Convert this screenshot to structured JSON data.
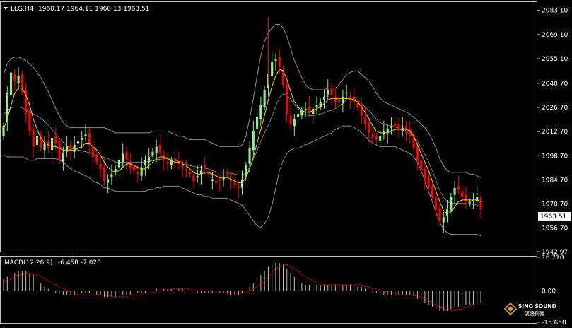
{
  "header": {
    "symbol_line": "LLG,H4",
    "ohlc": "1960.17 1964.11 1960.13 1963.51"
  },
  "macd_header": {
    "label": "MACD(12,26,9)",
    "values": "-6.458 -7.020"
  },
  "colors": {
    "background": "#000000",
    "axis": "#c0c0c0",
    "bull": "#90ee90",
    "bear": "#ff0000",
    "bands": "#8c8c8c",
    "ma": "#ffd400",
    "macd_hist": "#c0c0c0",
    "macd_signal": "#ff0000",
    "price_tag_bg": "#ffffff"
  },
  "logo": {
    "name": "SINO SOUND",
    "sub": "漢聲集團",
    "icon": "diamond-logo-icon"
  },
  "chart_data": [
    {
      "type": "candlestick",
      "panel": "main",
      "ylim": [
        1942.97,
        2087.5
      ],
      "y_ticks": [
        "2083.10",
        "2069.10",
        "2055.10",
        "2040.70",
        "2026.70",
        "2012.70",
        "1998.70",
        "1984.70",
        "1970.70",
        "1963.51",
        "1956.70",
        "1942.97"
      ],
      "y_tick_values": [
        2083.1,
        2069.1,
        2055.1,
        2040.7,
        2026.7,
        2012.7,
        1998.7,
        1984.7,
        1970.7,
        1956.7,
        1942.97
      ],
      "current_price": "1963.51",
      "current_price_value": 1963.51,
      "overlays": [
        "bollinger_upper",
        "bollinger_middle",
        "bollinger_lower",
        "moving_average"
      ],
      "close": [
        2016,
        2035,
        2047,
        2042,
        2045,
        2036,
        2023,
        2013,
        2004,
        2010,
        2003,
        2006,
        2003,
        2009,
        2006,
        1996,
        2000,
        2004,
        2002,
        2005,
        2007,
        2009,
        2011,
        2005,
        1998,
        1995,
        1991,
        1984,
        1985,
        1988,
        1991,
        1996,
        2000,
        1996,
        1992,
        1990,
        1988,
        1992,
        1996,
        1998,
        2001,
        2004,
        2000,
        1996,
        1994,
        1996,
        1996,
        1994,
        1992,
        1990,
        1988,
        1984,
        1987,
        1990,
        1992,
        1988,
        1985,
        1983,
        1984,
        1986,
        1988,
        1984,
        1982,
        1980,
        1985,
        1993,
        2003,
        2013,
        2021,
        2028,
        2037,
        2046,
        2053,
        2055,
        2050,
        2040,
        2023,
        2017,
        2020,
        2023,
        2025,
        2026,
        2024,
        2026,
        2028,
        2030,
        2033,
        2037,
        2034,
        2030,
        2030,
        2033,
        2034,
        2032,
        2030,
        2027,
        2022,
        2017,
        2012,
        2009,
        2008,
        2010,
        2013,
        2014,
        2016,
        2016,
        2014,
        2015,
        2013,
        2010,
        2003,
        1995,
        1990,
        1985,
        1980,
        1974,
        1967,
        1961,
        1963,
        1968,
        1975,
        1980,
        1979,
        1975,
        1972,
        1972,
        1973,
        1975,
        1968
      ],
      "open": [
        2010,
        2018,
        2034,
        2046,
        2041,
        2046,
        2037,
        2024,
        2014,
        2005,
        2011,
        2002,
        2007,
        2002,
        2010,
        2007,
        1995,
        2001,
        2005,
        2001,
        2006,
        2008,
        2010,
        2012,
        2004,
        1999,
        1994,
        1992,
        1983,
        1986,
        1989,
        1992,
        1995,
        2001,
        1995,
        1993,
        1989,
        1987,
        1993,
        1995,
        1999,
        2000,
        2005,
        1999,
        1995,
        1993,
        1997,
        1995,
        1993,
        1991,
        1989,
        1987,
        1986,
        1988,
        1993,
        1989,
        1984,
        1984,
        1985,
        1985,
        1989,
        1985,
        1983,
        1981,
        1980,
        1986,
        1994,
        2002,
        2014,
        2020,
        2027,
        2038,
        2045,
        2054,
        2056,
        2049,
        2041,
        2022,
        2016,
        2021,
        2022,
        2026,
        2027,
        2023,
        2027,
        2027,
        2031,
        2034,
        2038,
        2033,
        2031,
        2029,
        2034,
        2033,
        2033,
        2029,
        2028,
        2021,
        2018,
        2011,
        2010,
        2007,
        2011,
        2012,
        2015,
        2017,
        2017,
        2013,
        2016,
        2014,
        2011,
        2004,
        1996,
        1991,
        1986,
        1981,
        1975,
        1968,
        1960,
        1964,
        1967,
        1976,
        1981,
        1978,
        1976,
        1971,
        1973,
        1972,
        1974
      ],
      "bb_upper": [
        2046,
        2052,
        2055,
        2056,
        2056,
        2055,
        2054,
        2052,
        2050,
        2047,
        2044,
        2040,
        2036,
        2031,
        2026,
        2022,
        2018,
        2016,
        2015,
        2015,
        2015,
        2015,
        2015,
        2015,
        2015,
        2015,
        2015,
        2015,
        2014,
        2013,
        2012,
        2012,
        2012,
        2012,
        2012,
        2012,
        2012,
        2012,
        2012,
        2012,
        2013,
        2013,
        2013,
        2013,
        2013,
        2012,
        2011,
        2010,
        2010,
        2009,
        2008,
        2008,
        2008,
        2008,
        2008,
        2007,
        2006,
        2005,
        2004,
        2004,
        2004,
        2004,
        2004,
        2004,
        2005,
        2010,
        2020,
        2032,
        2045,
        2057,
        2065,
        2070,
        2073,
        2075,
        2075,
        2073,
        2068,
        2061,
        2054,
        2049,
        2044,
        2040,
        2038,
        2037,
        2037,
        2037,
        2037,
        2038,
        2038,
        2038,
        2040,
        2043,
        2046,
        2047,
        2048,
        2048,
        2046,
        2044,
        2042,
        2039,
        2035,
        2032,
        2030,
        2029,
        2028,
        2027,
        2026,
        2025,
        2024,
        2023,
        2021,
        2019,
        2017,
        2015,
        2012,
        2008,
        2003,
        1997,
        1993,
        1990,
        1989,
        1989,
        1989,
        1989,
        1989,
        1988,
        1988,
        1987,
        1986
      ],
      "bb_lower": [
        1999,
        1998,
        1998,
        1998,
        1998,
        1998,
        1997,
        1996,
        1996,
        1997,
        1997,
        1997,
        1997,
        1997,
        1997,
        1996,
        1995,
        1993,
        1991,
        1990,
        1989,
        1988,
        1987,
        1986,
        1984,
        1983,
        1982,
        1980,
        1980,
        1979,
        1978,
        1978,
        1978,
        1978,
        1978,
        1978,
        1978,
        1978,
        1978,
        1979,
        1979,
        1980,
        1980,
        1981,
        1981,
        1981,
        1981,
        1981,
        1980,
        1979,
        1978,
        1977,
        1976,
        1976,
        1975,
        1975,
        1974,
        1974,
        1974,
        1974,
        1974,
        1973,
        1972,
        1971,
        1970,
        1967,
        1964,
        1961,
        1958,
        1957,
        1959,
        1963,
        1970,
        1980,
        1990,
        1996,
        2000,
        2002,
        2003,
        2003,
        2004,
        2005,
        2006,
        2007,
        2008,
        2009,
        2010,
        2011,
        2012,
        2014,
        2015,
        2016,
        2016,
        2016,
        2015,
        2014,
        2012,
        2010,
        2008,
        2006,
        2005,
        2004,
        2004,
        2004,
        2004,
        2004,
        2003,
        2002,
        2001,
        2000,
        1998,
        1995,
        1990,
        1984,
        1978,
        1972,
        1966,
        1960,
        1956,
        1954,
        1953,
        1953,
        1953,
        1953,
        1953,
        1953,
        1953,
        1953,
        1952
      ],
      "ma": [
        2014,
        2020,
        2028,
        2035,
        2038,
        2038,
        2034,
        2028,
        2020,
        2014,
        2009,
        2006,
        2005,
        2004,
        2004,
        2003,
        2002,
        2002,
        2002,
        2002,
        2003,
        2004,
        2006,
        2006,
        2004,
        2002,
        1999,
        1995,
        1992,
        1990,
        1989,
        1990,
        1992,
        1994,
        1994,
        1993,
        1992,
        1991,
        1991,
        1993,
        1995,
        1997,
        1998,
        1998,
        1997,
        1996,
        1995,
        1995,
        1994,
        1993,
        1991,
        1989,
        1988,
        1988,
        1989,
        1989,
        1988,
        1987,
        1986,
        1986,
        1986,
        1985,
        1984,
        1983,
        1983,
        1986,
        1991,
        1998,
        2006,
        2014,
        2022,
        2031,
        2039,
        2045,
        2049,
        2048,
        2043,
        2036,
        2030,
        2027,
        2025,
        2024,
        2024,
        2025,
        2026,
        2027,
        2029,
        2031,
        2032,
        2032,
        2032,
        2032,
        2032,
        2032,
        2031,
        2030,
        2027,
        2024,
        2020,
        2016,
        2013,
        2012,
        2012,
        2012,
        2013,
        2014,
        2014,
        2014,
        2014,
        2013,
        2010,
        2005,
        2000,
        1995,
        1990,
        1984,
        1978,
        1972,
        1967,
        1965,
        1966,
        1969,
        1972,
        1973,
        1973,
        1973,
        1973,
        1973,
        1972
      ]
    },
    {
      "type": "bar",
      "panel": "macd",
      "ylim": [
        -15.658,
        16.718
      ],
      "y_ticks": [
        "16.718",
        "0.00",
        "-15.658"
      ],
      "y_tick_values": [
        16.718,
        0.0,
        -15.658
      ],
      "histogram": [
        6,
        7,
        8,
        9,
        10,
        10,
        10,
        9,
        8,
        6,
        4,
        2,
        1,
        0,
        -1,
        -1,
        -2,
        -2,
        -2,
        -2,
        -2,
        -1,
        -1,
        -1,
        -1,
        -2,
        -2,
        -3,
        -3,
        -3,
        -3,
        -3,
        -2,
        -2,
        -2,
        -1,
        -1,
        -1,
        -1,
        0,
        0,
        1,
        1,
        1,
        1,
        1,
        1,
        1,
        1,
        0,
        0,
        0,
        -1,
        -1,
        -1,
        -1,
        -1,
        -1,
        -1,
        -1,
        -1,
        -2,
        -2,
        -2,
        -1,
        0,
        2,
        4,
        6,
        8,
        10,
        12,
        13,
        14,
        14,
        13,
        11,
        9,
        7,
        5,
        4,
        3,
        3,
        3,
        3,
        3,
        3,
        3,
        3,
        3,
        3,
        3,
        3,
        3,
        3,
        2,
        2,
        1,
        0,
        -1,
        -1,
        -2,
        -2,
        -2,
        -2,
        -2,
        -2,
        -2,
        -2,
        -2,
        -3,
        -4,
        -5,
        -6,
        -7,
        -8,
        -9,
        -10,
        -10,
        -10,
        -9,
        -8,
        -8,
        -7,
        -7,
        -7,
        -7,
        -6,
        -6
      ],
      "signal": [
        4,
        5,
        6,
        7,
        8,
        8,
        9,
        9,
        8,
        8,
        7,
        6,
        5,
        4,
        3,
        2,
        1,
        0,
        -1,
        -1,
        -2,
        -2,
        -2,
        -2,
        -2,
        -2,
        -2,
        -2,
        -2,
        -3,
        -3,
        -3,
        -3,
        -3,
        -2,
        -2,
        -2,
        -2,
        -1,
        -1,
        -1,
        0,
        0,
        0,
        0,
        1,
        1,
        1,
        1,
        1,
        1,
        0,
        0,
        0,
        0,
        0,
        -1,
        -1,
        -1,
        -1,
        -1,
        -1,
        -1,
        -1,
        -1,
        -1,
        0,
        1,
        2,
        3,
        5,
        7,
        9,
        11,
        12,
        13,
        13,
        12,
        11,
        10,
        8,
        7,
        6,
        5,
        4,
        4,
        3,
        3,
        3,
        3,
        3,
        3,
        3,
        3,
        3,
        3,
        3,
        2,
        2,
        1,
        1,
        0,
        0,
        -1,
        -1,
        -1,
        -2,
        -2,
        -2,
        -2,
        -2,
        -3,
        -3,
        -4,
        -5,
        -6,
        -7,
        -8,
        -9,
        -9,
        -10,
        -10,
        -9,
        -9,
        -8,
        -8,
        -7,
        -7,
        -7,
        -7
      ]
    }
  ]
}
